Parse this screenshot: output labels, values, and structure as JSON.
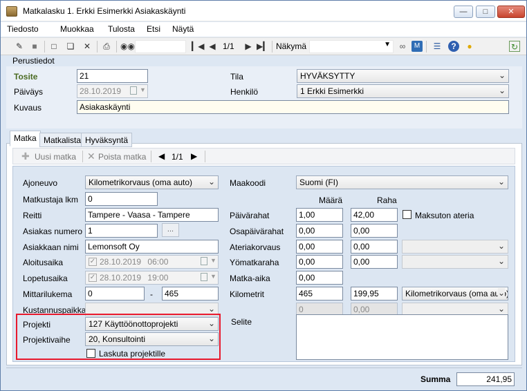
{
  "window": {
    "title": "Matkalasku 1. Erkki Esimerkki Asiakaskäynti"
  },
  "menu": [
    "Tiedosto",
    "Muokkaa",
    "Tulosta",
    "Etsi",
    "Näytä"
  ],
  "toolbar": {
    "record_counter": "1/1",
    "view_label": "Näkymä",
    "view_value": ""
  },
  "perustiedot": {
    "section_label": "Perustiedot",
    "tosite_label": "Tosite",
    "tosite_value": "21",
    "paivays_label": "Päiväys",
    "paivays_value": "28.10.2019",
    "kuvaus_label": "Kuvaus",
    "kuvaus_value": "Asiakaskäynti",
    "tila_label": "Tila",
    "tila_value": "HYVÄKSYTTY",
    "henkilo_label": "Henkilö",
    "henkilo_value": "1 Erkki Esimerkki"
  },
  "tabs": [
    "Matka",
    "Matkalista",
    "Hyväksyntä"
  ],
  "subtoolbar": {
    "add_label": "Uusi matka",
    "remove_label": "Poista matka",
    "counter": "1/1"
  },
  "left": {
    "ajoneuvo_label": "Ajoneuvo",
    "ajoneuvo_value": "Kilometrikorvaus (oma auto)",
    "matkustajia_label": "Matkustaja lkm",
    "matkustajia_value": "0",
    "reitti_label": "Reitti",
    "reitti_value": "Tampere - Vaasa - Tampere",
    "asiakasnro_label": "Asiakas numero",
    "asiakasnro_value": "1",
    "browse_label": "...",
    "asiakasnimi_label": "Asiakkaan nimi",
    "asiakasnimi_value": "Lemonsoft Oy",
    "aloitus_label": "Aloitusaika",
    "aloitus_date": "28.10.2019",
    "aloitus_time": "06:00",
    "lopetus_label": "Lopetusaika",
    "lopetus_date": "28.10.2019",
    "lopetus_time": "19:00",
    "mittari_label": "Mittarilukema",
    "mittari_start": "0",
    "mittari_dash": "-",
    "mittari_end": "465",
    "kustannus_label": "Kustannuspaikka",
    "kustannus_value": "",
    "projekti_label": "Projekti",
    "projekti_value": "127 Käyttöönottoprojekti",
    "projektivaihe_label": "Projektivaihe",
    "projektivaihe_value": "20, Konsultointi",
    "laskuta_label": "Laskuta projektille"
  },
  "right": {
    "maakoodi_label": "Maakoodi",
    "maakoodi_value": "Suomi (FI)",
    "maara_header": "Määrä",
    "raha_header": "Raha",
    "paivarahat_label": "Päivärahat",
    "paivarahat_maara": "1,00",
    "paivarahat_raha": "42,00",
    "maksuton_label": "Maksuton ateria",
    "osapaivarahat_label": "Osapäivärahat",
    "osapaivarahat_maara": "0,00",
    "osapaivarahat_raha": "0,00",
    "ateriakorvaus_label": "Ateriakorvaus",
    "ateriakorvaus_maara": "0,00",
    "ateriakorvaus_raha": "0,00",
    "yomatkaraha_label": "Yömatkaraha",
    "yomatkaraha_maara": "0,00",
    "yomatkaraha_raha": "0,00",
    "matkaaika_label": "Matka-aika",
    "matkaaika_value": "0,00",
    "kilometrit_label": "Kilometrit",
    "kilometrit_maara": "465",
    "kilometrit_raha": "199,95",
    "kilometrit_type": "Kilometrikorvaus (oma auto)",
    "extra_maara": "0",
    "extra_raha": "0,00",
    "selite_label": "Selite",
    "selite_value": ""
  },
  "footer": {
    "summa_label": "Summa",
    "summa_value": "241,95"
  }
}
